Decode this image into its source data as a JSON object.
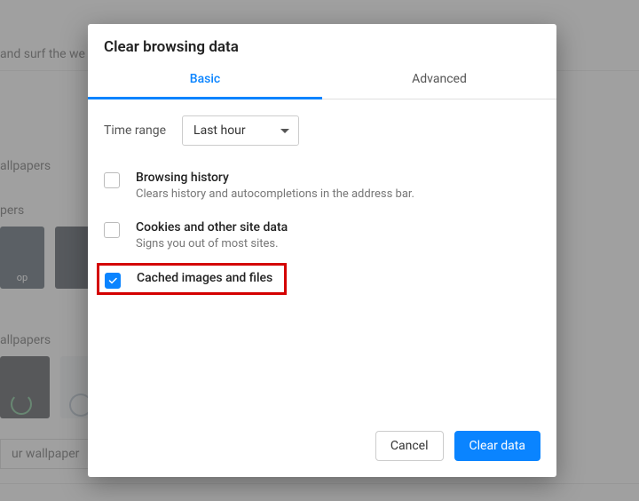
{
  "background": {
    "banner_text": "and surf the we",
    "section1_label": "allpapers",
    "section2_label": "pers",
    "thumb1_text": "op",
    "section3_label": "allpapers",
    "upload_button": "ur wallpaper"
  },
  "dialog": {
    "title": "Clear browsing data",
    "tabs": {
      "basic": "Basic",
      "advanced": "Advanced"
    },
    "time_range": {
      "label": "Time range",
      "value": "Last hour"
    },
    "options": {
      "browsing_history": {
        "title": "Browsing history",
        "subtitle": "Clears history and autocompletions in the address bar.",
        "checked": false
      },
      "cookies": {
        "title": "Cookies and other site data",
        "subtitle": "Signs you out of most sites.",
        "checked": false
      },
      "cached": {
        "title": "Cached images and files",
        "checked": true
      }
    },
    "buttons": {
      "cancel": "Cancel",
      "clear": "Clear data"
    }
  }
}
